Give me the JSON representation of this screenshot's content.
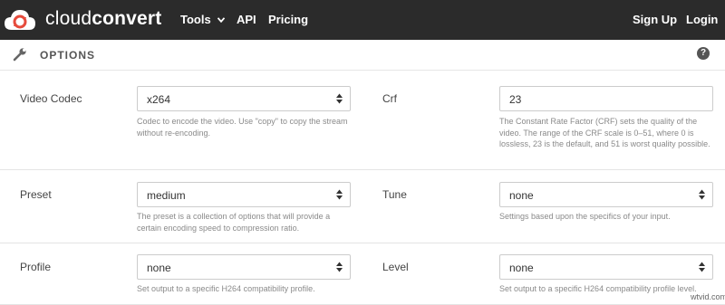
{
  "app": {
    "brand_light": "cloud",
    "brand_bold": "convert",
    "logo_icon": "cloud-logo-icon",
    "accent_color": "#e64b3c"
  },
  "nav": {
    "tools": "Tools",
    "api": "API",
    "pricing": "Pricing",
    "sign_up": "Sign Up",
    "login": "Login"
  },
  "options": {
    "title": "OPTIONS",
    "help": "?"
  },
  "fields": {
    "video_codec": {
      "label": "Video Codec",
      "value": "x264",
      "hint": "Codec to encode the video. Use \"copy\" to copy the stream without re-encoding."
    },
    "crf": {
      "label": "Crf",
      "value": "23",
      "hint": "The Constant Rate Factor (CRF) sets the quality of the video. The range of the CRF scale is 0–51, where 0 is lossless, 23 is the default, and 51 is worst quality possible."
    },
    "preset": {
      "label": "Preset",
      "value": "medium",
      "hint": "The preset is a collection of options that will provide a certain encoding speed to compression ratio."
    },
    "tune": {
      "label": "Tune",
      "value": "none",
      "hint": "Settings based upon the specifics of your input."
    },
    "profile": {
      "label": "Profile",
      "value": "none",
      "hint": "Set output to a specific H264 compatibility profile."
    },
    "level": {
      "label": "Level",
      "value": "none",
      "hint": "Set output to a specific H264 compatibility profile level."
    }
  },
  "watermark": "wtvid.com"
}
